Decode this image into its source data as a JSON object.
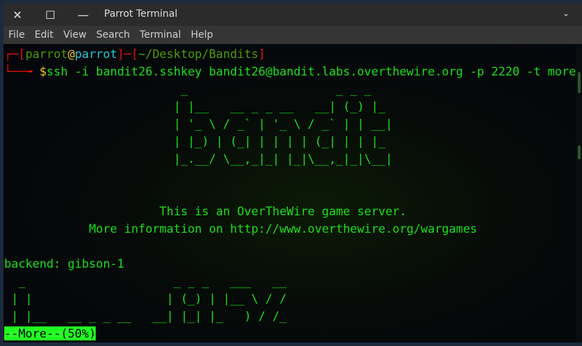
{
  "window": {
    "title": "Parrot Terminal",
    "close_icon": "close-icon",
    "maximize_icon": "maximize-icon",
    "minimize_icon": "minimize-icon",
    "collapse_icon": "chevron-down-icon"
  },
  "menu": [
    "File",
    "Edit",
    "View",
    "Search",
    "Terminal",
    "Help"
  ],
  "prompt": {
    "user": "parrot",
    "at": "@",
    "host": "parrot",
    "path": "~/Desktop/Bandits",
    "dollar": "$",
    "command": "ssh -i bandit26.sshkey bandit26@bandit.labs.overthewire.org -p 2220 -t more"
  },
  "banner": [
    "                         _                     _ _ _   ",
    "                        | |__   __ _ _ __   __| (_) |_ ",
    "                        | '_ \\ / _` | '_ \\ / _` | | __|",
    "                        | |_) | (_| | | | | (_| | | |_ ",
    "                        |_.__/ \\__,_|_| |_|\\__,_|_|\\__|",
    "",
    "",
    "                      This is an OverTheWire game server.",
    "            More information on http://www.overthewire.org/wargames",
    "",
    "backend: gibson-1",
    "  _                     _ _ _   ___   __",
    " | |                   | (_) | |__ \\ / /",
    " | |__   __ _ _ __   __| |_| |_   ) / /_"
  ],
  "pager_status": "--More--(50%)"
}
